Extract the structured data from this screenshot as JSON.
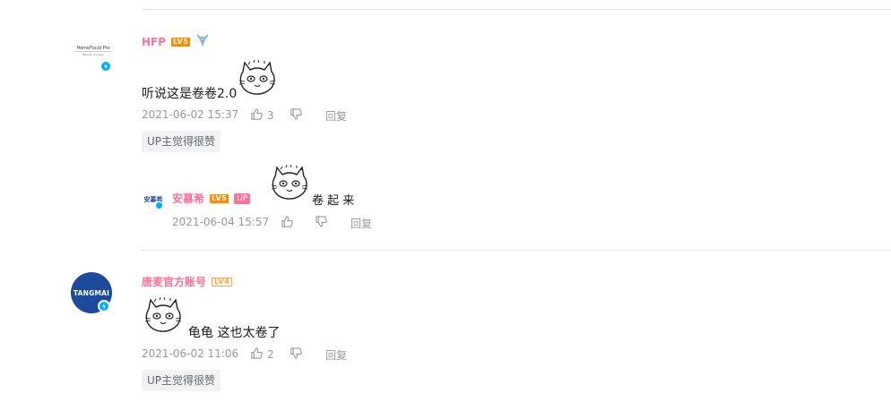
{
  "comments": [
    {
      "user": "HFP",
      "level": "LV5",
      "avatar_text_1": "HomeFocid Pro",
      "avatar_text_2": "Beauty Courses",
      "content": "听说这是卷卷2.0",
      "time": "2021-06-02 15:37",
      "likes": "3",
      "reply_label": "回复",
      "tag": "UP主觉得很赞",
      "sub_reply": {
        "user": "安慕希",
        "level": "LV5",
        "role": "UP",
        "avatar_text": "安慕希",
        "content": "卷 起 来",
        "time": "2021-06-04 15:57",
        "reply_label": "回复"
      }
    },
    {
      "user": "唐麦官方账号",
      "level": "LV4",
      "avatar_text": "TANGMAI",
      "content": "龟龟 这也太卷了",
      "time": "2021-06-02 11:06",
      "likes": "2",
      "reply_label": "回复",
      "tag": "UP主觉得很赞"
    }
  ],
  "colors": {
    "accent": "#fb7299",
    "meta": "#9499a0",
    "level": "#ff8a00",
    "verify": "#00aeec",
    "tangmai": "#1e4a9c"
  },
  "icons": [
    "like-icon",
    "dislike-icon",
    "verified-icon",
    "cat-sticker-icon",
    "fox-fan-badge-icon"
  ]
}
